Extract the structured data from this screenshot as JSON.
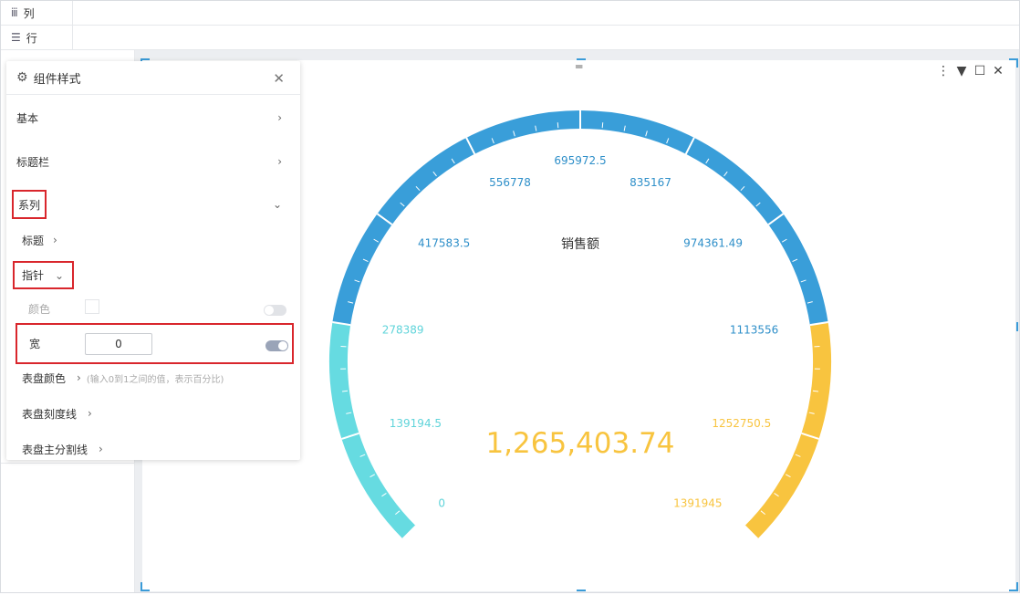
{
  "shelf": {
    "columns_label": "列",
    "rows_label": "行"
  },
  "panel": {
    "title": "组件样式",
    "items": {
      "basic": "基本",
      "title_bar": "标题栏",
      "series": "系列",
      "title": "标题",
      "pointer": "指针",
      "color": "颜色",
      "width": "宽",
      "width_value": "0",
      "dial_color": "表盘颜色",
      "dial_hint": "(输入0到1之间的值，表示百分比)",
      "dial_ticks": "表盘刻度线",
      "dial_main_split": "表盘主分割线"
    }
  },
  "chart_data": {
    "type": "gauge",
    "title": "销售额",
    "value_label": "1,265,403.74",
    "value": 1265403.74,
    "min": 0,
    "max": 1391945,
    "ticks": [
      "0",
      "139194.5",
      "278389",
      "417583.5",
      "556778",
      "695972.5",
      "835167",
      "974361.49",
      "1113556",
      "1252750.5",
      "1391945"
    ],
    "bands": [
      {
        "to": 0.2,
        "color": "#66dbe1"
      },
      {
        "to": 0.8,
        "color": "#399ed9"
      },
      {
        "to": 1.0,
        "color": "#f8c43f"
      }
    ]
  },
  "colors": {
    "accent": "#3a9bd8",
    "highlight": "#d9262c",
    "value": "#f8c43f"
  }
}
